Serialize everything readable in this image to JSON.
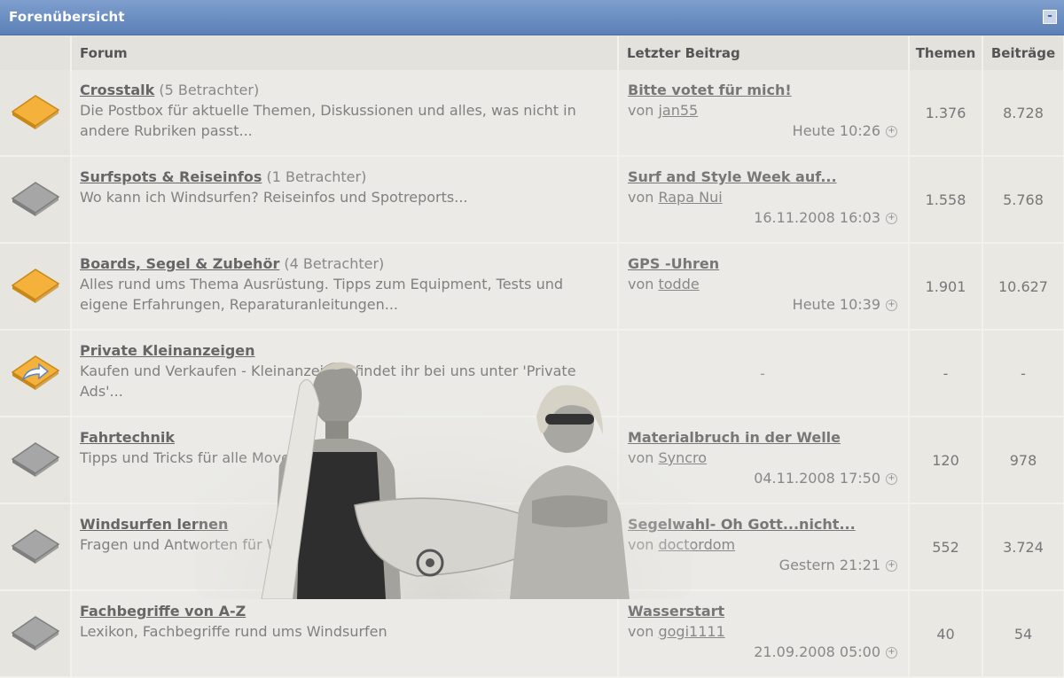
{
  "panel": {
    "title": "Forenübersicht",
    "collapse_glyph": "-"
  },
  "columns": {
    "forum": "Forum",
    "last_post": "Letzter Beitrag",
    "topics": "Themen",
    "posts": "Beiträge"
  },
  "forums": [
    {
      "icon": "folder-new-icon",
      "name": "Crosstalk",
      "viewers": "(5 Betrachter)",
      "desc": "Die Postbox für aktuelle Themen, Diskussionen und alles, was nicht in andere Rubriken passt...",
      "last_title": "Bitte votet für mich!",
      "last_by_prefix": "von ",
      "last_by": "jan55",
      "last_time": "Heute 10:26",
      "topics": "1.376",
      "posts": "8.728"
    },
    {
      "icon": "folder-icon",
      "name": "Surfspots & Reiseinfos",
      "viewers": "(1 Betrachter)",
      "desc": "Wo kann ich Windsurfen? Reiseinfos und Spotreports...",
      "last_title": "Surf and Style Week auf...",
      "last_by_prefix": "von ",
      "last_by": "Rapa Nui",
      "last_time": "16.11.2008 16:03",
      "topics": "1.558",
      "posts": "5.768"
    },
    {
      "icon": "folder-new-icon",
      "name": "Boards, Segel & Zubehör",
      "viewers": "(4 Betrachter)",
      "desc": "Alles rund ums Thema Ausrüstung. Tipps zum Equipment, Tests und eigene Erfahrungen, Reparaturanleitungen...",
      "last_title": "GPS -Uhren",
      "last_by_prefix": "von ",
      "last_by": "todde",
      "last_time": "Heute 10:39",
      "topics": "1.901",
      "posts": "10.627"
    },
    {
      "icon": "folder-link-icon",
      "name": "Private Kleinanzeigen",
      "viewers": "",
      "desc": "Kaufen und Verkaufen - Kleinanzeigen findet ihr bei uns unter 'Private Ads'...",
      "last_empty": "-",
      "topics": "-",
      "posts": "-"
    },
    {
      "icon": "folder-icon",
      "name": "Fahrtechnik",
      "viewers": "",
      "desc": "Tipps und Tricks für alle Moves",
      "last_title": "Materialbruch in der Welle",
      "last_by_prefix": "von ",
      "last_by": "Syncro",
      "last_time": "04.11.2008 17:50",
      "topics": "120",
      "posts": "978"
    },
    {
      "icon": "folder-icon",
      "name": "Windsurfen lernen",
      "viewers": "",
      "desc": "Fragen und Antworten für Windsurfer",
      "last_title": "Segelwahl- Oh Gott...nicht...",
      "last_by_prefix": "von ",
      "last_by": "doctordom",
      "last_time": "Gestern 21:21",
      "topics": "552",
      "posts": "3.724"
    },
    {
      "icon": "folder-icon",
      "name": "Fachbegriffe von A-Z",
      "viewers": "",
      "desc": "Lexikon, Fachbegriffe rund ums Windsurfen",
      "last_title": "Wasserstart",
      "last_by_prefix": "von ",
      "last_by": "gogi1111",
      "last_time": "21.09.2008 05:00",
      "topics": "40",
      "posts": "54"
    }
  ],
  "colors": {
    "header_blue": "#5b7fb6",
    "folder_new": "#f4b23c",
    "folder_old": "#a6a6a6"
  }
}
